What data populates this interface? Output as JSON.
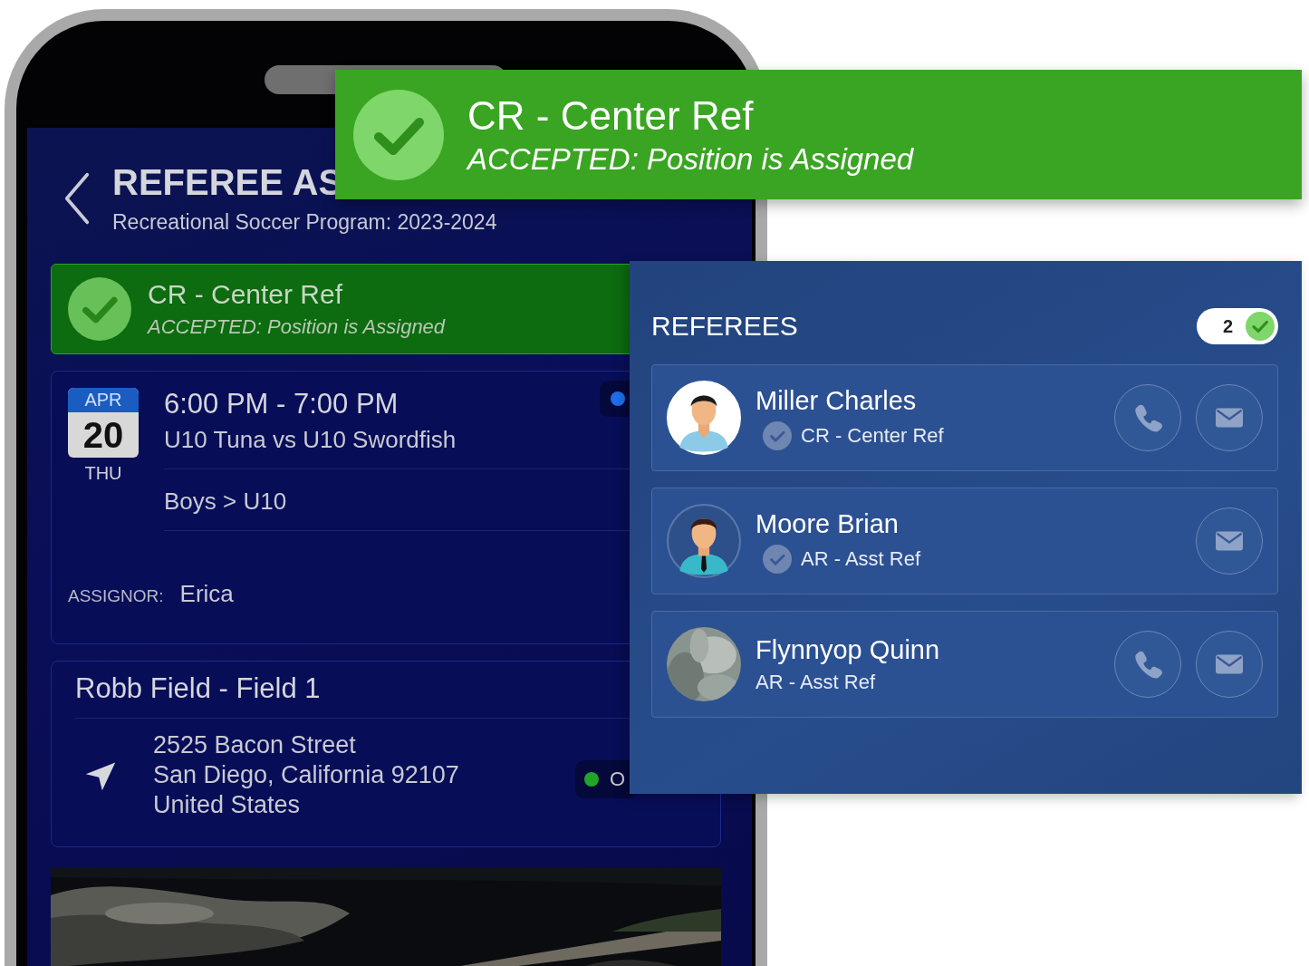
{
  "header": {
    "title": "REFEREE AS",
    "subtitle": "Recreational Soccer Program: 2023-2024"
  },
  "status_card": {
    "accepted": true,
    "title": "CR - Center Ref",
    "message": "ACCEPTED: Position is Assigned"
  },
  "event": {
    "month": "APR",
    "day": "20",
    "weekday": "THU",
    "time": "6:00 PM - 7:00 PM",
    "teams": "U10 Tuna vs U10 Swordfish",
    "division": "Boys > U10",
    "assignor_label": "ASSIGNOR:",
    "assignor": "Erica"
  },
  "location": {
    "name": "Robb Field - Field 1",
    "address_lines": [
      "2525 Bacon Street",
      "San Diego, California 92107",
      "United States"
    ],
    "status_text": "O"
  },
  "banner": {
    "accepted": true,
    "title": "CR - Center Ref",
    "message": "ACCEPTED: Position is Assigned"
  },
  "referees_panel": {
    "title": "REFEREES",
    "count": "2",
    "referees": [
      {
        "name": "Miller Charles",
        "role": "CR - Center Ref",
        "confirmed": true,
        "phone": true,
        "kind": "collar"
      },
      {
        "name": "Moore Brian",
        "role": "AR - Asst Ref",
        "confirmed": true,
        "phone": false,
        "kind": "tie"
      },
      {
        "name": "Flynnyop Quinn",
        "role": "AR - Asst Ref",
        "confirmed": false,
        "phone": true
      }
    ]
  }
}
